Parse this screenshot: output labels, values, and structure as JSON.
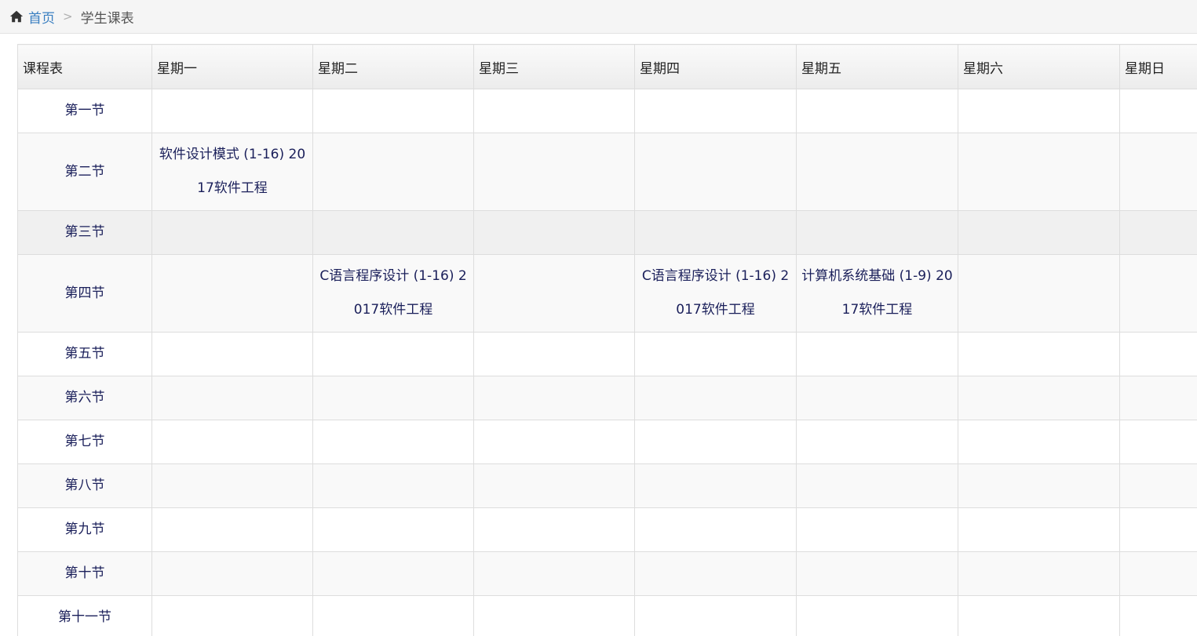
{
  "breadcrumb": {
    "home_label": "首页",
    "current_label": "学生课表"
  },
  "table": {
    "headers": [
      "课程表",
      "星期一",
      "星期二",
      "星期三",
      "星期四",
      "星期五",
      "星期六",
      "星期日"
    ],
    "rows": [
      {
        "label": "第一节",
        "cells": [
          "",
          "",
          "",
          "",
          "",
          "",
          ""
        ]
      },
      {
        "label": "第二节",
        "cells": [
          "软件设计模式 (1-16) 2017软件工程",
          "",
          "",
          "",
          "",
          "",
          ""
        ]
      },
      {
        "label": "第三节",
        "cells": [
          "",
          "",
          "",
          "",
          "",
          "",
          ""
        ]
      },
      {
        "label": "第四节",
        "cells": [
          "",
          "C语言程序设计 (1-16) 2017软件工程",
          "",
          "C语言程序设计 (1-16) 2017软件工程",
          "计算机系统基础 (1-9) 2017软件工程",
          "",
          ""
        ]
      },
      {
        "label": "第五节",
        "cells": [
          "",
          "",
          "",
          "",
          "",
          "",
          ""
        ]
      },
      {
        "label": "第六节",
        "cells": [
          "",
          "",
          "",
          "",
          "",
          "",
          ""
        ]
      },
      {
        "label": "第七节",
        "cells": [
          "",
          "",
          "",
          "",
          "",
          "",
          ""
        ]
      },
      {
        "label": "第八节",
        "cells": [
          "",
          "",
          "",
          "",
          "",
          "",
          ""
        ]
      },
      {
        "label": "第九节",
        "cells": [
          "",
          "",
          "",
          "",
          "",
          "",
          ""
        ]
      },
      {
        "label": "第十节",
        "cells": [
          "",
          "",
          "",
          "",
          "",
          "",
          ""
        ]
      },
      {
        "label": "第十一节",
        "cells": [
          "",
          "",
          "",
          "",
          "",
          "",
          ""
        ]
      }
    ]
  },
  "colors": {
    "link": "#3a7fc1",
    "course_text": "#1a1f5a",
    "border": "#dddddd"
  }
}
